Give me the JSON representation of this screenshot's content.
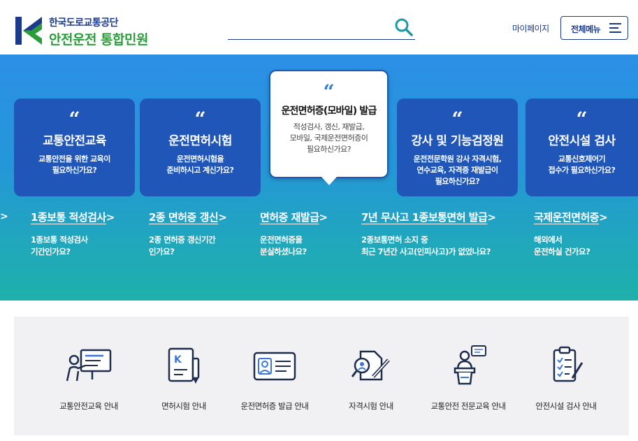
{
  "header": {
    "org_name": "한국도로교통공단",
    "site_title": "안전운전 통합민원",
    "search": {
      "placeholder": "",
      "value": ""
    },
    "mypage_label": "마이페이지",
    "menu_label": "전체메뉴"
  },
  "hero": {
    "quote_mark": "“",
    "cards": [
      {
        "title": "교통안전교육",
        "desc": "교통안전을 위한 교육이\n필요하신가요?"
      },
      {
        "title": "운전면허시험",
        "desc": "운전면허시험을\n준비하시고 계신가요?"
      },
      {
        "title": "운전면허증(모바일) 발급",
        "desc": "적성검사, 갱신, 재발급,\n모바일, 국제운전면허증이\n필요하신가요?",
        "active": true
      },
      {
        "title": "강사 및 기능검정원",
        "desc": "운전전문학원 강사 자격시험,\n연수교육, 자격증 재발급이\n필요하신가요?"
      },
      {
        "title": "안전시설 검사",
        "desc": "교통신호제어기\n접수가 필요하신가요?"
      }
    ],
    "left_arrow": ">",
    "sub_links": [
      {
        "title": "1종보통 적성검사",
        "desc": "1종보통 적성검사\n기간인가요?"
      },
      {
        "title": "2종 면허증 갱신",
        "desc": "2종 면허증 갱신기간\n인가요?"
      },
      {
        "title": "면허증 재발급",
        "desc": "운전면허증을\n분실하셨나요?"
      },
      {
        "title": "7년 무사고 1종보통면허 발급",
        "desc": "2종보통면허 소지 중\n최근 7년간 사고(인피사고)가 없었나요?"
      },
      {
        "title": "국제운전면허증",
        "desc": "해외에서\n운전하실 건가요?"
      }
    ],
    "arrow_glyph": ">"
  },
  "services": [
    {
      "label": "교통안전교육 안내",
      "icon": "teacher-board-icon"
    },
    {
      "label": "면허시험 안내",
      "icon": "license-document-pen-icon"
    },
    {
      "label": "운전면허증 발급 안내",
      "icon": "id-card-icon"
    },
    {
      "label": "자격시험 안내",
      "icon": "exam-search-pen-icon"
    },
    {
      "label": "교통안전 전문교육 안내",
      "icon": "lecturer-podium-icon"
    },
    {
      "label": "안전시설 검사 안내",
      "icon": "clipboard-checklist-icon"
    }
  ],
  "colors": {
    "brand_navy": "#1b3a8c",
    "brand_green": "#2a9d3a",
    "card_blue": "#1f56b8",
    "hero_top": "#2c8fe6",
    "hero_bottom": "#1fb0aa",
    "panel_gray": "#f1f1f3"
  }
}
